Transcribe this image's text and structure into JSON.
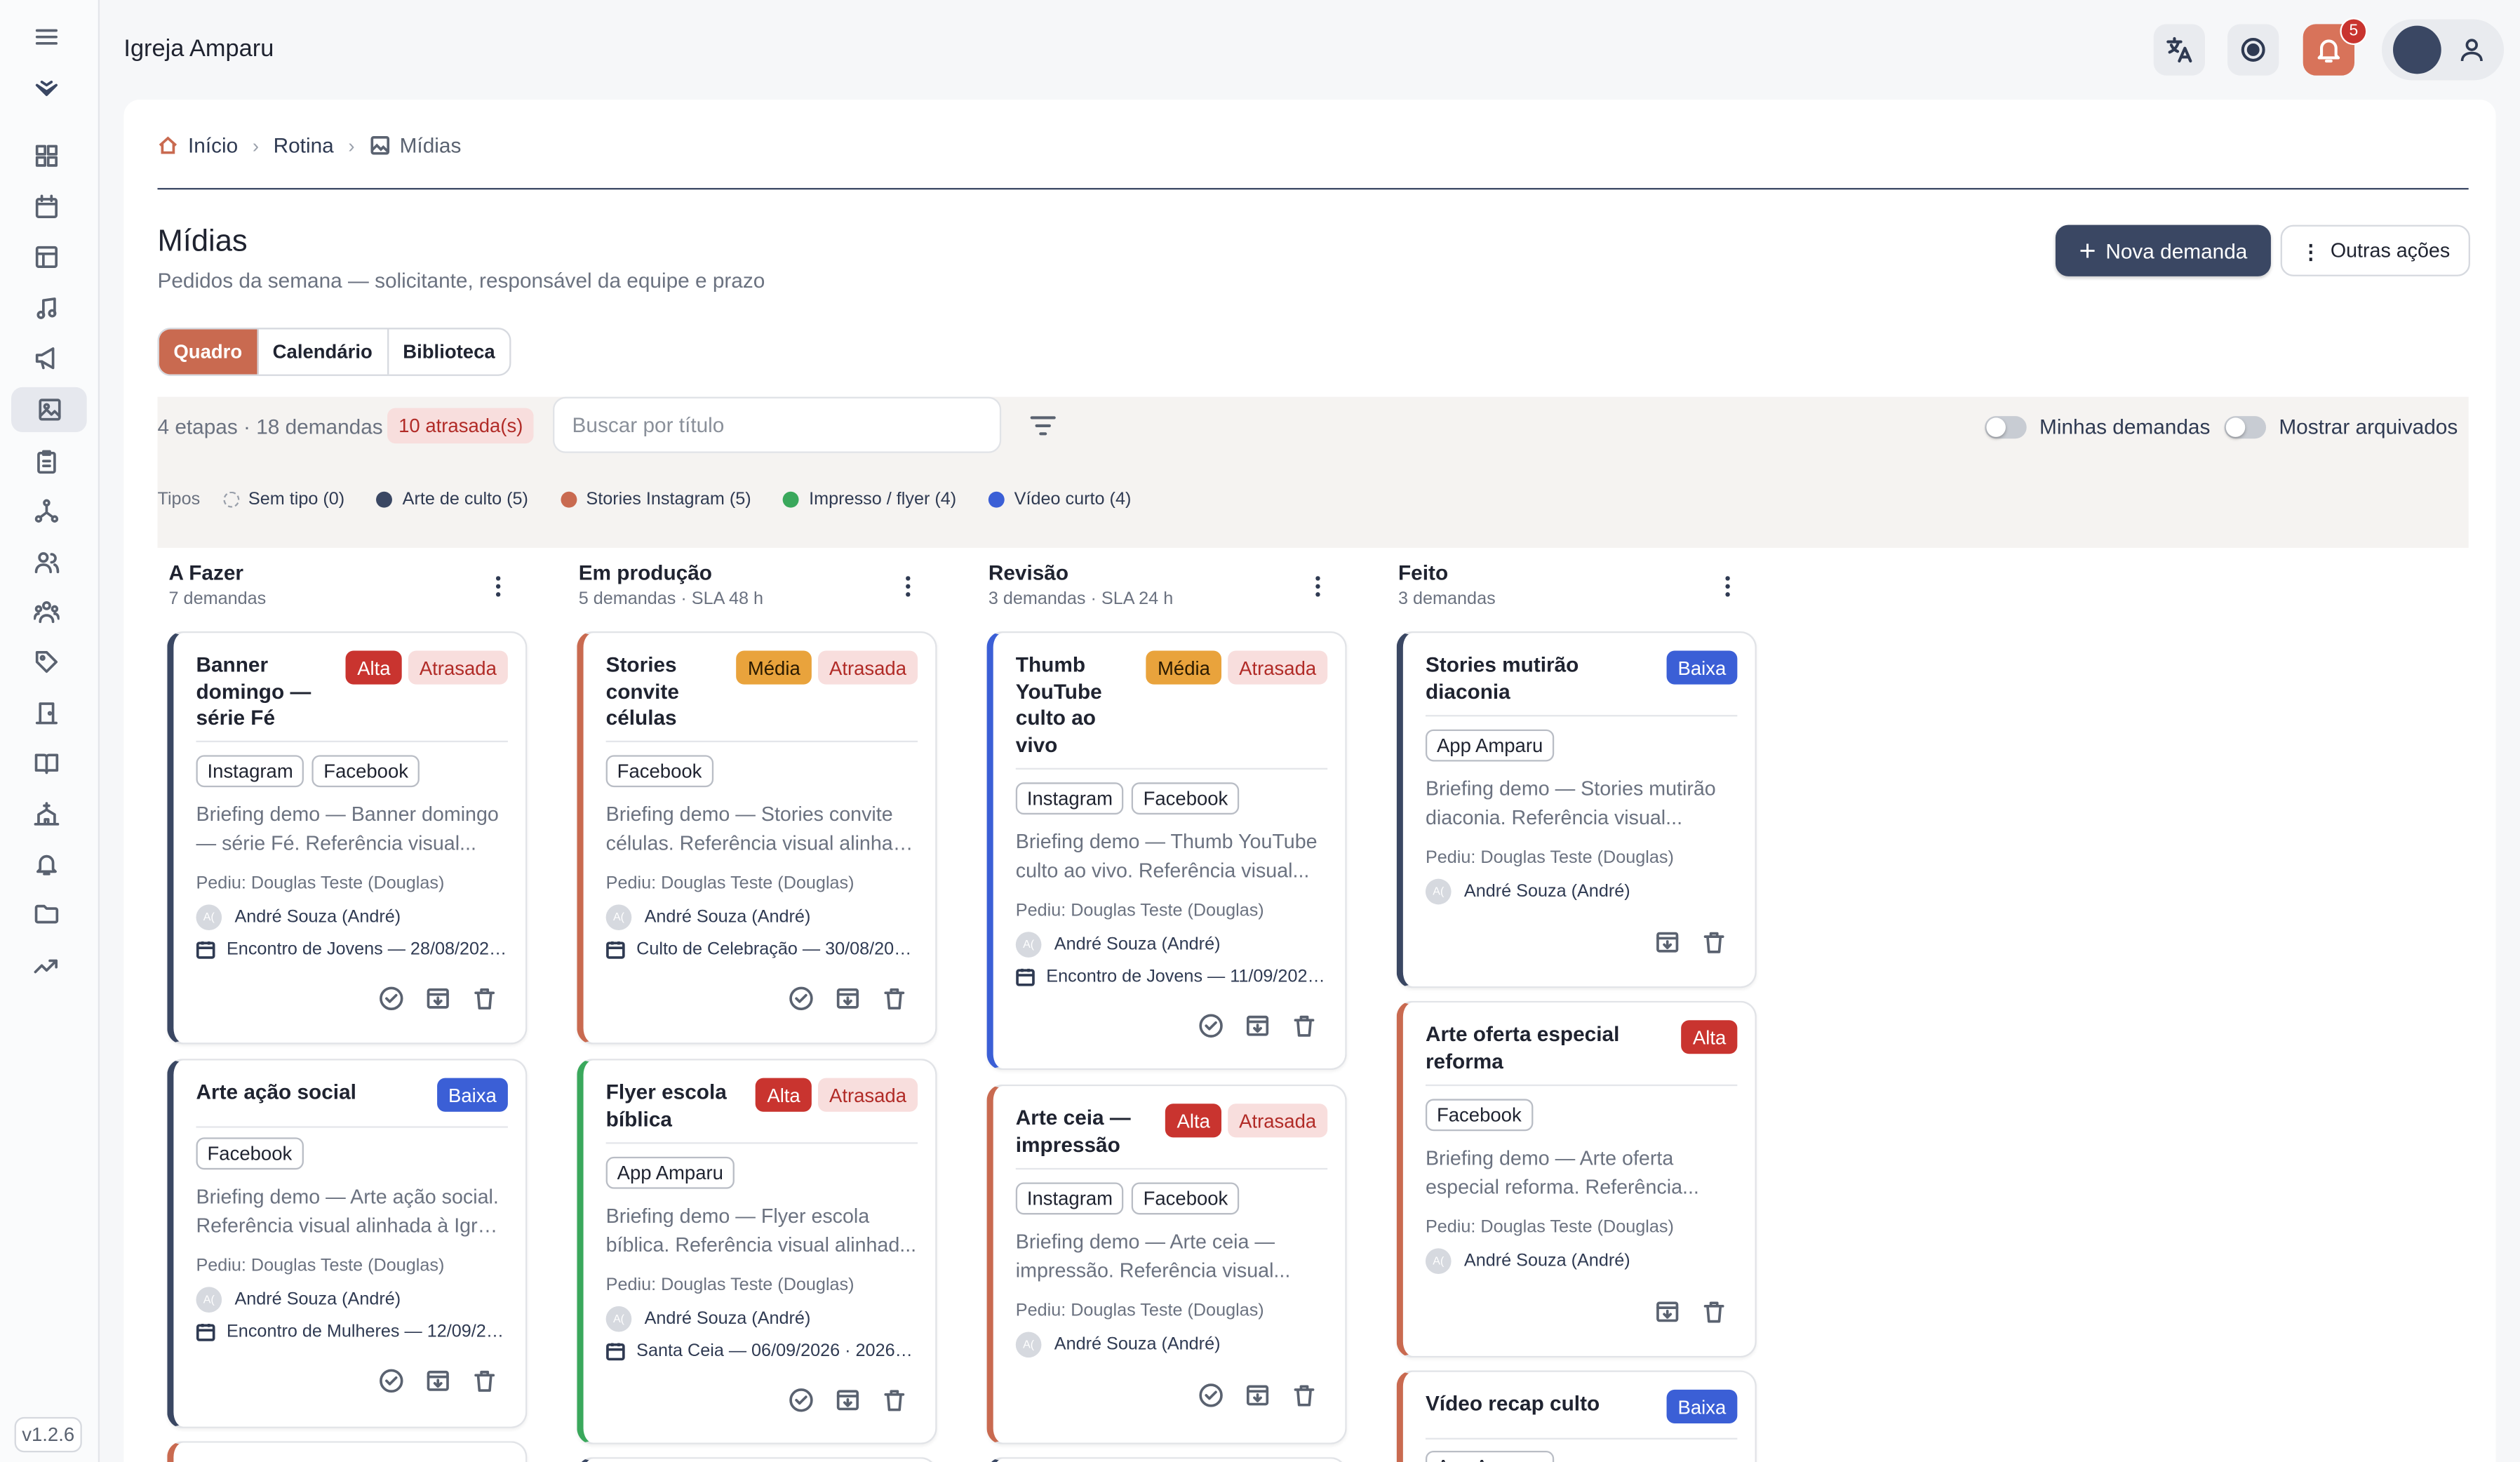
{
  "app": {
    "title": "Igreja Amparu",
    "version": "v1.2.6",
    "notifications": "5"
  },
  "breadcrumb": {
    "home": "Início",
    "section": "Rotina",
    "current": "Mídias"
  },
  "page": {
    "title": "Mídias",
    "subtitle": "Pedidos da semana — solicitante, responsável da equipe e prazo"
  },
  "actions": {
    "primary": "Nova demanda",
    "secondary": "Outras ações"
  },
  "views": [
    "Quadro",
    "Calendário",
    "Biblioteca"
  ],
  "filters": {
    "summary": "4 etapas · 18 demandas",
    "late_badge": "10 atrasada(s)",
    "search_placeholder": "Buscar por título",
    "toggle_mine": "Minhas demandas",
    "toggle_archived": "Mostrar arquivados",
    "types_label": "Tipos",
    "types": [
      {
        "label": "Sem tipo (0)",
        "color": ""
      },
      {
        "label": "Arte de culto (5)",
        "color": "#3a4763"
      },
      {
        "label": "Stories Instagram (5)",
        "color": "#c96a50"
      },
      {
        "label": "Impresso / flyer (4)",
        "color": "#3aa85c"
      },
      {
        "label": "Vídeo curto (4)",
        "color": "#3b5fd6"
      }
    ]
  },
  "columns": [
    {
      "title": "A Fazer",
      "subtitle": "7 demandas",
      "cards": [
        {
          "title": [
            "Banner",
            "domingo —",
            "série Fé"
          ],
          "priority": "Alta",
          "late": "Atrasada",
          "tags": [
            "Instagram",
            "Facebook"
          ],
          "brief": [
            "Briefing demo — Banner domingo",
            "— série Fé. Referência visual..."
          ],
          "requester": "Pediu: Douglas Teste (Douglas)",
          "initials": "A(",
          "assignee": "André Souza (André)",
          "event": "Encontro de Jovens — 28/08/2026 ..."
        },
        {
          "title": [
            "Arte ação social"
          ],
          "priority": "Baixa",
          "late": "",
          "tags": [
            "Facebook"
          ],
          "brief": [
            "Briefing demo — Arte ação social.",
            "Referência visual alinhada à Igrej..."
          ],
          "requester": "Pediu: Douglas Teste (Douglas)",
          "initials": "A(",
          "assignee": "André Souza (André)",
          "event": "Encontro de Mulheres — 12/09/20..."
        }
      ]
    },
    {
      "title": "Em produção",
      "subtitle": "5 demandas · SLA 48 h",
      "cards": [
        {
          "title": [
            "Stories",
            "convite",
            "células"
          ],
          "priority": "Média",
          "late": "Atrasada",
          "tags": [
            "Facebook"
          ],
          "brief": [
            "Briefing demo — Stories convite",
            "células. Referência visual alinhad..."
          ],
          "requester": "Pediu: Douglas Teste (Douglas)",
          "initials": "A(",
          "assignee": "André Souza (André)",
          "event": "Culto de Celebração — 30/08/202..."
        },
        {
          "title": [
            "Flyer escola",
            "bíblica"
          ],
          "priority": "Alta",
          "late": "Atrasada",
          "tags": [
            "App Amparu"
          ],
          "brief": [
            "Briefing demo — Flyer escola",
            "bíblica. Referência visual alinhad..."
          ],
          "requester": "Pediu: Douglas Teste (Douglas)",
          "initials": "A(",
          "assignee": "André Souza (André)",
          "event": "Santa Ceia — 06/09/2026 · 2026-0..."
        }
      ]
    },
    {
      "title": "Revisão",
      "subtitle": "3 demandas · SLA 24 h",
      "cards": [
        {
          "title": [
            "Thumb",
            "YouTube",
            "culto ao",
            "vivo"
          ],
          "priority": "Média",
          "late": "Atrasada",
          "tags": [
            "Instagram",
            "Facebook"
          ],
          "brief": [
            "Briefing demo — Thumb YouTube",
            "culto ao vivo. Referência visual..."
          ],
          "requester": "Pediu: Douglas Teste (Douglas)",
          "initials": "A(",
          "assignee": "André Souza (André)",
          "event": "Encontro de Jovens — 11/09/2026 ·..."
        },
        {
          "title": [
            "Arte ceia —",
            "impressão"
          ],
          "priority": "Alta",
          "late": "Atrasada",
          "tags": [
            "Instagram",
            "Facebook"
          ],
          "brief": [
            "Briefing demo — Arte ceia —",
            "impressão. Referência visual..."
          ],
          "requester": "Pediu: Douglas Teste (Douglas)",
          "initials": "A(",
          "assignee": "André Souza (André)",
          "event": ""
        }
      ]
    },
    {
      "title": "Feito",
      "subtitle": "3 demandas",
      "cards": [
        {
          "title": [
            "Stories mutirão",
            "diaconia"
          ],
          "priority": "Baixa",
          "late": "",
          "tags": [
            "App Amparu"
          ],
          "brief": [
            "Briefing demo — Stories mutirão",
            "diaconia. Referência visual..."
          ],
          "requester": "Pediu: Douglas Teste (Douglas)",
          "initials": "A(",
          "assignee": "André Souza (André)",
          "event": ""
        },
        {
          "title": [
            "Arte oferta especial",
            "reforma"
          ],
          "priority": "Alta",
          "late": "",
          "tags": [
            "Facebook"
          ],
          "brief": [
            "Briefing demo — Arte oferta",
            "especial reforma. Referência..."
          ],
          "requester": "Pediu: Douglas Teste (Douglas)",
          "initials": "A(",
          "assignee": "André Souza (André)",
          "event": ""
        },
        {
          "title": [
            "Vídeo recap culto"
          ],
          "priority": "Baixa",
          "late": "",
          "tags": [
            "App Amparu"
          ],
          "brief": [],
          "requester": "",
          "initials": "",
          "assignee": "",
          "event": ""
        }
      ]
    }
  ]
}
